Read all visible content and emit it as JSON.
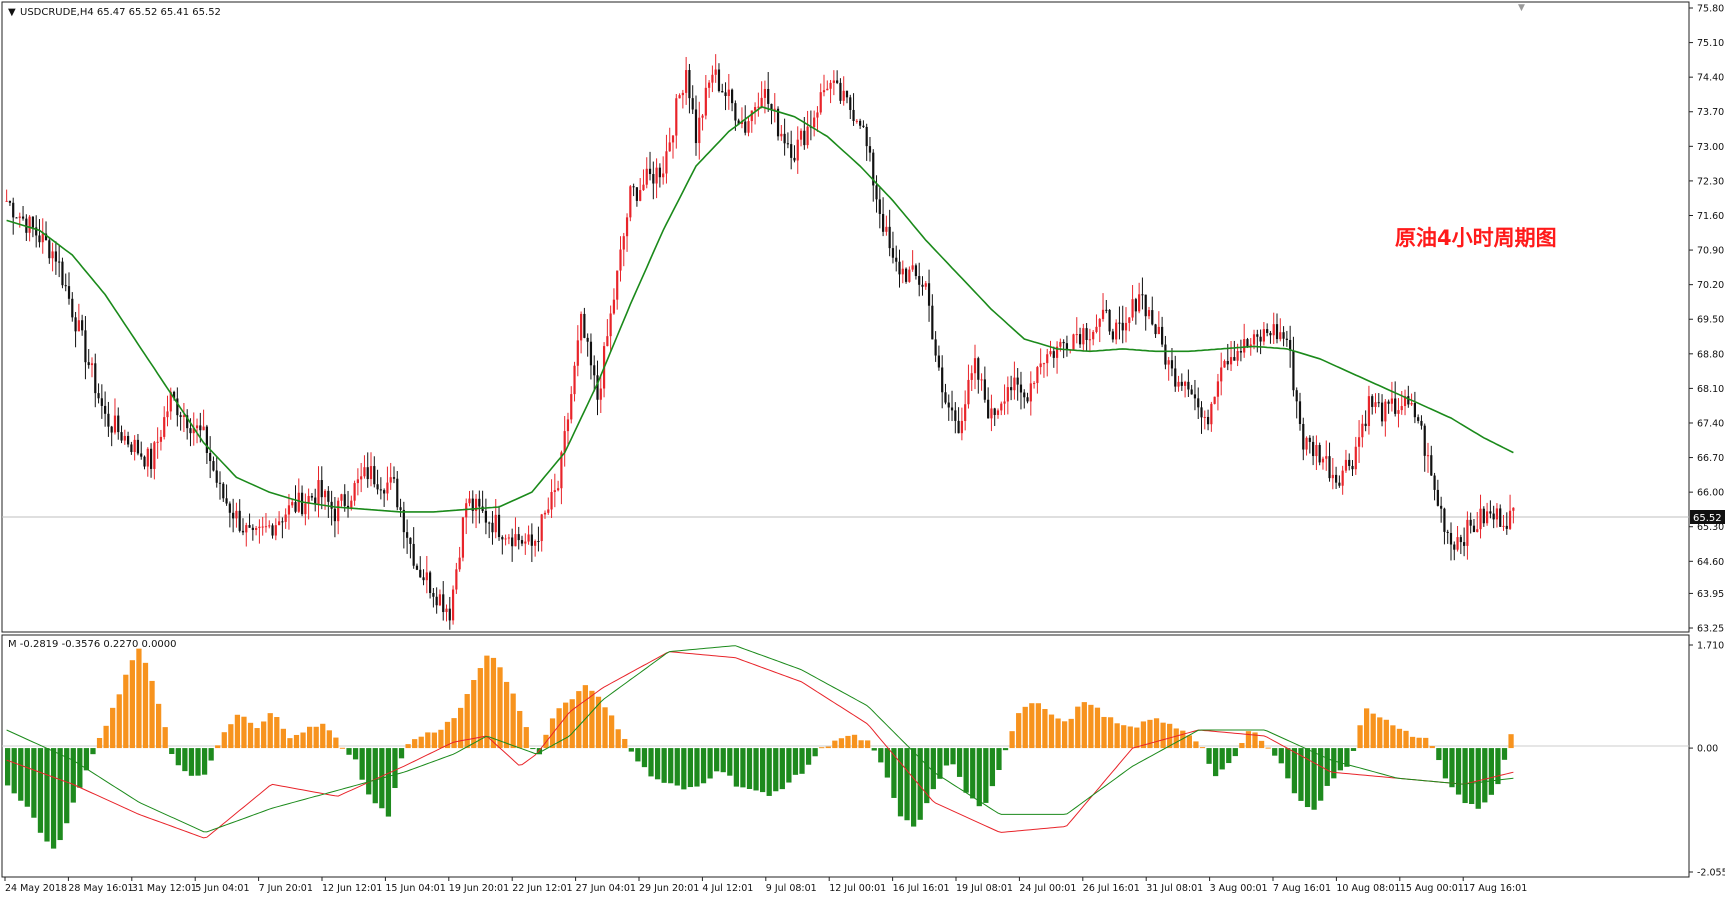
{
  "header": {
    "symbol_line": "USDCRUDE,H4  65.47 65.52 65.41 65.52",
    "indicator_line": "M -0.2819 -0.3576 0.2270 0.0000",
    "annotation": "原油4小时周期图"
  },
  "colors": {
    "bull": "#e8242a",
    "bear": "#111111",
    "ma": "#1b8a1b",
    "hist_pos": "#f7931e",
    "hist_neg": "#1e8a1e",
    "macd_line": "#e8242a",
    "signal_line": "#1b8a1b",
    "annotation": "#ff1a1a",
    "price_tag_bg": "#111111"
  },
  "price_axis": {
    "ticks": [
      "75.80",
      "75.10",
      "74.40",
      "73.70",
      "73.00",
      "72.30",
      "71.60",
      "70.90",
      "70.20",
      "69.50",
      "68.80",
      "68.10",
      "67.40",
      "66.70",
      "66.00",
      "65.30",
      "64.60",
      "63.95",
      "63.25"
    ],
    "current_price": "65.52"
  },
  "indicator_axis": {
    "ticks": [
      "1.7101",
      "0.00",
      "-2.0556"
    ]
  },
  "time_axis": {
    "labels": [
      "24 May 2018",
      "28 May 16:01",
      "31 May 12:01",
      "5 Jun 04:01",
      "7 Jun 20:01",
      "12 Jun 12:01",
      "15 Jun 04:01",
      "19 Jun 20:01",
      "22 Jun 12:01",
      "27 Jun 04:01",
      "29 Jun 20:01",
      "4 Jul 12:01",
      "9 Jul 08:01",
      "12 Jul 00:01",
      "16 Jul 16:01",
      "19 Jul 08:01",
      "24 Jul 00:01",
      "26 Jul 16:01",
      "31 Jul 08:01",
      "3 Aug 00:01",
      "7 Aug 16:01",
      "10 Aug 08:01",
      "15 Aug 00:01",
      "17 Aug 16:01"
    ]
  },
  "chart_data": [
    {
      "type": "candlestick",
      "series": [
        {
          "kind": "candles",
          "bars": 230,
          "path_x": [
            0,
            15,
            30,
            44,
            50,
            60,
            65,
            75,
            85,
            95,
            100,
            110,
            118,
            125,
            135,
            140,
            150,
            160,
            168,
            175,
            180,
            190,
            200,
            207,
            210,
            215,
            225,
            230
          ],
          "path_close": [
            71.9,
            70.8,
            67.5,
            66.6,
            67.9,
            67.1,
            66.0,
            65.0,
            65.6,
            66.0,
            65.6,
            66.4,
            66.1,
            64.5,
            63.6,
            65.8,
            65.3,
            64.9,
            66.1,
            69.4,
            67.9,
            72.0,
            72.6,
            74.6,
            73.2,
            74.5,
            73.4,
            74.2
          ]
        },
        {
          "kind": "candles_2",
          "path_x": [
            0,
            5,
            10,
            15,
            20,
            25,
            30,
            35,
            40,
            45,
            50,
            55,
            60,
            65,
            70,
            75,
            80,
            85,
            90,
            95,
            100,
            105,
            110,
            115,
            120,
            125,
            130,
            135,
            140,
            145,
            150,
            155,
            160,
            165,
            170,
            175,
            180,
            185,
            190,
            195,
            200,
            205,
            210,
            215,
            220,
            225,
            229
          ],
          "path_close": [
            74.2,
            73.4,
            72.9,
            73.5,
            74.3,
            73.9,
            73.6,
            72.0,
            70.6,
            70.4,
            70.2,
            67.9,
            67.4,
            68.5,
            67.5,
            68.2,
            67.9,
            68.7,
            68.9,
            69.2,
            69.3,
            69.5,
            69.1,
            70.1,
            69.3,
            68.4,
            68.3,
            67.3,
            68.7,
            68.9,
            69.0,
            69.3,
            69.1,
            67.0,
            66.8,
            66.3,
            66.7,
            67.8,
            67.6,
            67.8,
            67.5,
            66.0,
            65.0,
            65.2,
            65.5,
            65.5,
            65.5
          ]
        },
        {
          "kind": "ma",
          "name": "",
          "x": [
            0,
            10,
            20,
            30,
            40,
            50,
            60,
            65,
            70,
            75,
            80,
            85,
            90,
            95,
            100,
            105,
            110,
            115,
            120,
            125,
            130,
            135,
            140,
            145,
            150,
            155,
            160,
            165,
            170,
            175,
            180,
            185,
            190,
            195,
            200,
            205,
            210,
            215,
            220,
            225,
            230
          ],
          "y": [
            71.5,
            71.3,
            70.9,
            70.2,
            69.2,
            68.0,
            66.8,
            66.3,
            66.1,
            65.9,
            65.8,
            65.75,
            65.7,
            65.65,
            65.75,
            65.8,
            66.3,
            67.5,
            68.7,
            70.0,
            71.2,
            72.5,
            73.2,
            73.8,
            73.9,
            73.6,
            73.1,
            72.4,
            71.5,
            70.7,
            70.0,
            69.3,
            68.9,
            68.9,
            69.1,
            68.9,
            68.8,
            68.9,
            68.8,
            68.8,
            69.0
          ]
        }
      ],
      "ylim": [
        63.25,
        75.8
      ]
    },
    {
      "type": "bar",
      "name": "",
      "x": [
        0,
        5,
        10,
        15,
        20,
        25,
        30,
        35,
        40,
        45,
        50,
        55,
        60,
        65,
        70,
        75,
        80,
        85,
        90,
        95,
        100,
        105,
        110,
        115,
        120,
        125,
        130,
        135,
        140,
        145,
        150,
        155,
        160,
        165,
        170,
        175,
        180,
        185,
        190,
        195,
        200,
        205,
        210,
        215,
        220,
        225,
        230,
        235,
        240,
        245,
        250,
        255,
        260,
        265,
        270,
        275,
        280,
        285,
        290,
        295,
        300,
        305,
        310,
        315,
        320,
        325,
        330,
        335,
        340,
        345,
        350,
        355,
        360,
        365,
        370,
        375,
        380,
        385,
        390,
        395,
        400,
        405,
        410,
        415,
        420,
        425,
        430,
        435,
        440,
        445,
        450,
        455
      ],
      "values": [
        -0.6,
        -0.9,
        -1.4,
        -1.7,
        -0.9,
        -0.2,
        0.4,
        1.1,
        1.7,
        0.9,
        -0.2,
        -0.5,
        -0.4,
        0.2,
        0.6,
        0.3,
        0.6,
        0.2,
        0.3,
        0.4,
        0.1,
        -0.2,
        -0.9,
        -1.1,
        0.05,
        0.2,
        0.3,
        0.5,
        1.0,
        1.6,
        1.2,
        0.6,
        -0.2,
        0.6,
        0.8,
        1.1,
        0.7,
        0.3,
        -0.2,
        -0.5,
        -0.6,
        -0.7,
        -0.6,
        -0.3,
        -0.6,
        -0.7,
        -0.8,
        -0.6,
        -0.4,
        -0.05,
        0.15,
        0.2,
        0.1,
        -0.4,
        -1.2,
        -1.3,
        -0.6,
        -0.2,
        -0.8,
        -1.0,
        -0.3,
        0.6,
        0.8,
        0.6,
        0.4,
        0.8,
        0.6,
        0.4,
        0.3,
        0.5,
        0.4,
        0.3,
        0.1,
        -0.5,
        -0.2,
        0.3,
        0.1,
        -0.3,
        -0.9,
        -1.0,
        -0.5,
        -0.3,
        0.7,
        0.5,
        0.3,
        0.2,
        0.1,
        -0.6,
        -0.9,
        -1.0,
        -0.6,
        0.4
      ],
      "ylim": [
        -2.0556,
        1.7101
      ]
    },
    {
      "type": "line",
      "series": [
        {
          "name": "",
          "x": [
            0,
            20,
            40,
            60,
            80,
            100,
            120,
            135,
            145,
            155,
            160,
            170,
            180,
            200,
            220,
            240,
            260,
            280,
            300,
            320,
            340,
            360,
            380,
            400,
            420,
            440,
            455
          ],
          "values": [
            -0.2,
            -0.6,
            -1.1,
            -1.5,
            -0.6,
            -0.8,
            -0.3,
            0.1,
            0.2,
            -0.3,
            -0.1,
            0.6,
            1.0,
            1.6,
            1.5,
            1.1,
            0.4,
            -0.9,
            -1.4,
            -1.3,
            0.0,
            0.3,
            0.2,
            -0.4,
            -0.5,
            -0.6,
            -0.4
          ]
        },
        {
          "name": "",
          "x": [
            0,
            20,
            40,
            60,
            80,
            100,
            120,
            135,
            145,
            155,
            160,
            170,
            180,
            200,
            220,
            240,
            260,
            280,
            300,
            320,
            340,
            360,
            380,
            400,
            420,
            440,
            455
          ],
          "values": [
            0.3,
            -0.2,
            -0.9,
            -1.4,
            -1.0,
            -0.7,
            -0.4,
            -0.1,
            0.2,
            0.0,
            -0.1,
            0.2,
            0.8,
            1.6,
            1.7,
            1.3,
            0.7,
            -0.4,
            -1.1,
            -1.1,
            -0.3,
            0.3,
            0.3,
            -0.2,
            -0.5,
            -0.6,
            -0.5
          ]
        }
      ],
      "ylim": [
        -2.0556,
        1.7101
      ]
    }
  ]
}
